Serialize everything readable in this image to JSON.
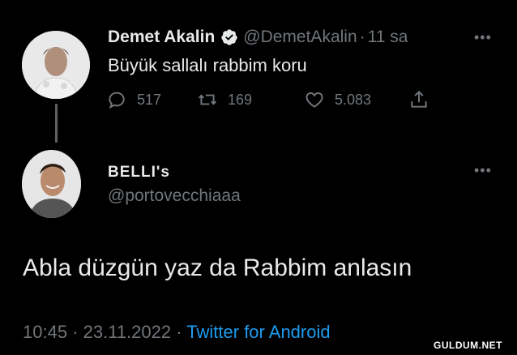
{
  "tweet": {
    "author_name": "Demet Akalin",
    "author_handle": "@DemetAkalin",
    "time_ago": "11 sa",
    "text": "Büyük sallalı rabbim koru",
    "replies": "517",
    "retweets": "169",
    "likes": "5.083",
    "more_icon": "ellipsis-icon",
    "verified_icon": "verified-badge-icon",
    "accent_color": "#1d9bf0"
  },
  "reply": {
    "author_name": "BELLI's",
    "author_handle": "@portovecchiaaa",
    "text": "Abla düzgün yaz da Rabbim anlasın",
    "time": "10:45",
    "date": "23.11.2022",
    "source": "Twitter for Android"
  },
  "watermark": "GULDUM.NET"
}
